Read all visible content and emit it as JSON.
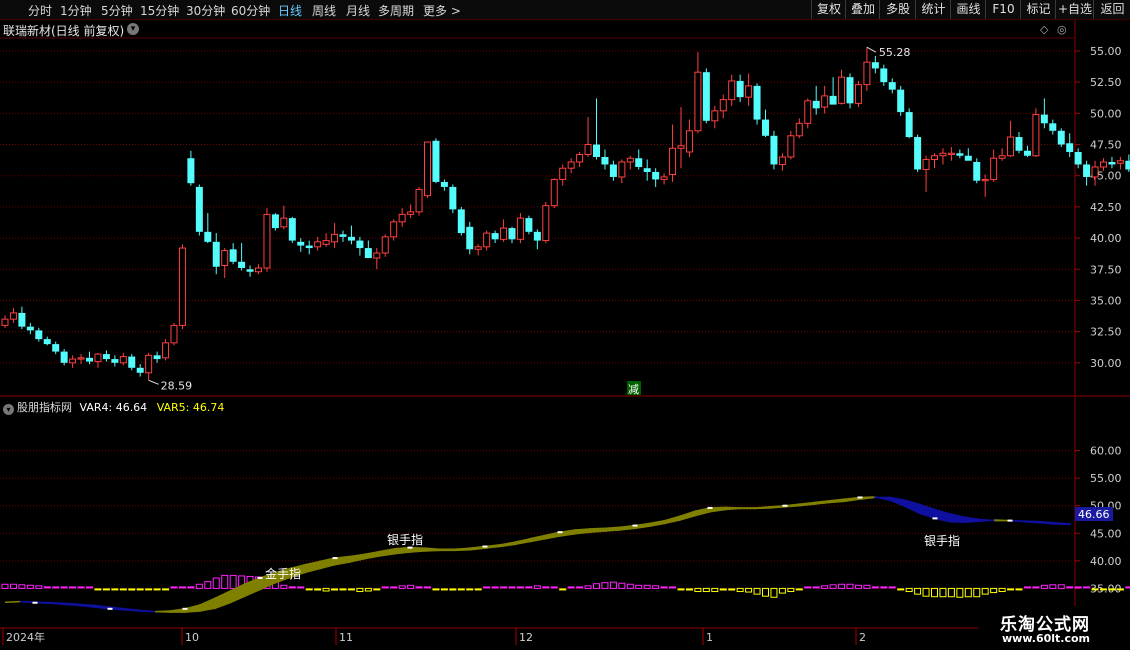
{
  "toolbar": {
    "periods": [
      "分时",
      "1分钟",
      "5分钟",
      "15分钟",
      "30分钟",
      "60分钟",
      "日线",
      "周线",
      "月线",
      "多周期",
      "更多 >"
    ],
    "active_period": "日线",
    "right_buttons": [
      "复权",
      "叠加",
      "多股",
      "统计",
      "画线",
      "F10",
      "标记",
      "+自选",
      "返回"
    ]
  },
  "stock": {
    "title": "联瑞新材(日线 前复权)"
  },
  "indicator": {
    "name": "股朋指标网",
    "var4": "VAR4: 46.64",
    "var5": "VAR5: 46.74",
    "var4_color": "#ffffff",
    "var5_color": "#ffff00",
    "current_value": "46.66"
  },
  "annotations": {
    "high": "55.28",
    "low": "28.59",
    "reduce_marker": "减",
    "gold_finger": "金手指",
    "silver_finger_1": "银手指",
    "silver_finger_2": "银手指"
  },
  "time_axis": {
    "labels": [
      "2024年",
      "10",
      "11",
      "12",
      "1",
      "2"
    ]
  },
  "watermark": {
    "line1": "乐淘公式网",
    "line2": "www.60lt.com"
  },
  "colors": {
    "up": "#ff4040",
    "down": "#54fcfc",
    "ribbon_up": "#808000",
    "ribbon_down": "#1010a0",
    "magenta": "#ff20ff",
    "yellow": "#ffff00",
    "grid": "#6e0000"
  },
  "chart_data": [
    {
      "type": "candlestick",
      "title": "联瑞新材(日线 前复权)",
      "y_ticks": [
        30.0,
        32.5,
        35.0,
        37.5,
        40.0,
        42.5,
        45.0,
        47.5,
        50.0,
        52.5,
        55.0
      ],
      "ylim": [
        27.5,
        56.2
      ],
      "high_label": 55.28,
      "low_label": 28.59,
      "ohlc": [
        [
          33.0,
          33.8,
          32.8,
          33.5
        ],
        [
          33.5,
          34.4,
          33.2,
          34.0
        ],
        [
          34.0,
          34.5,
          32.7,
          32.9
        ],
        [
          32.9,
          33.2,
          32.3,
          32.6
        ],
        [
          32.6,
          32.8,
          31.7,
          31.9
        ],
        [
          31.9,
          32.1,
          31.4,
          31.5
        ],
        [
          31.5,
          31.7,
          30.7,
          30.9
        ],
        [
          30.9,
          31.1,
          29.8,
          30.0
        ],
        [
          30.0,
          30.6,
          29.6,
          30.3
        ],
        [
          30.3,
          30.7,
          29.9,
          30.4
        ],
        [
          30.4,
          30.9,
          29.9,
          30.1
        ],
        [
          30.1,
          30.8,
          29.6,
          30.7
        ],
        [
          30.7,
          31.0,
          30.1,
          30.3
        ],
        [
          30.3,
          30.6,
          29.7,
          30.0
        ],
        [
          30.0,
          30.8,
          29.8,
          30.5
        ],
        [
          30.5,
          30.7,
          29.4,
          29.6
        ],
        [
          29.6,
          29.9,
          28.9,
          29.2
        ],
        [
          29.2,
          30.8,
          28.6,
          30.6
        ],
        [
          30.6,
          30.9,
          30.0,
          30.3
        ],
        [
          30.4,
          31.9,
          30.2,
          31.6
        ],
        [
          31.6,
          33.2,
          31.4,
          33.0
        ],
        [
          33.0,
          39.5,
          32.7,
          39.2
        ],
        [
          46.4,
          47.0,
          44.2,
          44.4
        ],
        [
          44.1,
          44.3,
          40.2,
          40.5
        ],
        [
          40.5,
          42.0,
          39.6,
          39.7
        ],
        [
          39.7,
          40.4,
          37.1,
          37.7
        ],
        [
          37.8,
          39.2,
          36.8,
          39.0
        ],
        [
          39.1,
          39.6,
          37.9,
          38.1
        ],
        [
          38.1,
          39.6,
          37.4,
          37.6
        ],
        [
          37.5,
          37.8,
          36.9,
          37.3
        ],
        [
          37.3,
          37.9,
          37.1,
          37.6
        ],
        [
          37.6,
          42.4,
          37.3,
          41.9
        ],
        [
          41.9,
          42.0,
          40.6,
          40.8
        ],
        [
          40.9,
          42.6,
          40.7,
          41.6
        ],
        [
          41.6,
          41.7,
          39.6,
          39.8
        ],
        [
          39.7,
          40.0,
          38.9,
          39.4
        ],
        [
          39.4,
          39.8,
          38.7,
          39.2
        ],
        [
          39.3,
          40.1,
          39.0,
          39.7
        ],
        [
          39.5,
          40.4,
          39.3,
          39.8
        ],
        [
          39.7,
          41.2,
          39.2,
          40.3
        ],
        [
          40.3,
          40.6,
          39.7,
          40.1
        ],
        [
          40.1,
          41.0,
          39.5,
          39.8
        ],
        [
          39.8,
          40.1,
          38.6,
          39.2
        ],
        [
          39.2,
          39.8,
          38.6,
          38.4
        ],
        [
          38.4,
          39.2,
          37.5,
          38.8
        ],
        [
          38.8,
          40.3,
          38.5,
          40.1
        ],
        [
          40.1,
          41.5,
          39.8,
          41.3
        ],
        [
          41.3,
          42.4,
          40.9,
          41.9
        ],
        [
          41.9,
          42.7,
          41.6,
          42.1
        ],
        [
          42.1,
          44.1,
          41.8,
          43.9
        ],
        [
          43.4,
          47.6,
          43.2,
          47.7
        ],
        [
          47.8,
          48.0,
          44.4,
          44.5
        ],
        [
          44.5,
          44.7,
          43.8,
          44.1
        ],
        [
          44.1,
          44.3,
          42.0,
          42.3
        ],
        [
          42.3,
          42.5,
          40.2,
          40.4
        ],
        [
          40.9,
          41.3,
          38.7,
          39.1
        ],
        [
          39.1,
          39.5,
          38.6,
          39.3
        ],
        [
          39.3,
          40.6,
          39.0,
          40.4
        ],
        [
          40.4,
          40.6,
          39.6,
          39.9
        ],
        [
          39.9,
          41.5,
          39.7,
          40.8
        ],
        [
          40.8,
          40.9,
          39.6,
          39.9
        ],
        [
          39.9,
          42.0,
          39.6,
          41.6
        ],
        [
          41.6,
          41.8,
          40.3,
          40.5
        ],
        [
          40.5,
          40.7,
          39.1,
          39.8
        ],
        [
          39.8,
          42.9,
          39.6,
          42.6
        ],
        [
          42.6,
          44.8,
          42.4,
          44.7
        ],
        [
          44.7,
          45.9,
          44.2,
          45.6
        ],
        [
          45.6,
          46.4,
          45.2,
          46.1
        ],
        [
          46.1,
          46.9,
          45.7,
          46.7
        ],
        [
          46.7,
          49.7,
          46.5,
          47.5
        ],
        [
          47.5,
          51.2,
          46.3,
          46.5
        ],
        [
          46.5,
          47.1,
          45.5,
          45.9
        ],
        [
          45.9,
          46.2,
          44.6,
          44.9
        ],
        [
          44.9,
          46.3,
          44.4,
          46.1
        ],
        [
          46.1,
          46.6,
          45.5,
          46.4
        ],
        [
          46.4,
          47.1,
          45.5,
          45.7
        ],
        [
          45.6,
          46.3,
          44.6,
          45.3
        ],
        [
          45.3,
          45.6,
          44.1,
          44.7
        ],
        [
          44.7,
          45.2,
          44.3,
          44.9
        ],
        [
          45.1,
          49.1,
          44.5,
          47.2
        ],
        [
          47.2,
          50.5,
          45.6,
          47.4
        ],
        [
          46.9,
          49.5,
          46.5,
          48.6
        ],
        [
          48.6,
          54.9,
          48.4,
          53.3
        ],
        [
          53.3,
          53.6,
          49.2,
          49.4
        ],
        [
          49.4,
          50.6,
          48.8,
          50.2
        ],
        [
          50.2,
          51.5,
          49.6,
          51.1
        ],
        [
          51.1,
          53.1,
          50.6,
          52.6
        ],
        [
          52.6,
          53.1,
          50.9,
          51.3
        ],
        [
          51.3,
          53.2,
          50.6,
          52.2
        ],
        [
          52.2,
          52.4,
          49.1,
          49.5
        ],
        [
          49.5,
          50.3,
          48.1,
          48.2
        ],
        [
          48.2,
          48.6,
          45.5,
          45.9
        ],
        [
          45.9,
          46.8,
          45.4,
          46.5
        ],
        [
          46.5,
          48.6,
          46.3,
          48.2
        ],
        [
          48.2,
          49.6,
          48.0,
          49.2
        ],
        [
          49.2,
          51.2,
          48.8,
          51.0
        ],
        [
          51.0,
          52.2,
          49.9,
          50.4
        ],
        [
          50.5,
          52.2,
          50.0,
          51.4
        ],
        [
          51.4,
          52.9,
          50.9,
          50.7
        ],
        [
          50.8,
          53.5,
          50.7,
          52.9
        ],
        [
          52.9,
          53.2,
          50.4,
          50.8
        ],
        [
          50.8,
          52.6,
          50.5,
          52.3
        ],
        [
          52.3,
          55.3,
          51.8,
          54.1
        ],
        [
          54.1,
          54.6,
          53.2,
          53.6
        ],
        [
          53.6,
          53.9,
          52.2,
          52.5
        ],
        [
          52.5,
          52.8,
          51.6,
          51.9
        ],
        [
          51.9,
          52.2,
          49.8,
          50.1
        ],
        [
          50.1,
          50.4,
          48.0,
          48.1
        ],
        [
          48.1,
          48.3,
          45.3,
          45.5
        ],
        [
          45.5,
          46.6,
          43.7,
          46.3
        ],
        [
          46.3,
          46.8,
          45.6,
          46.6
        ],
        [
          46.6,
          47.2,
          45.9,
          46.8
        ],
        [
          46.7,
          47.3,
          46.2,
          46.8
        ],
        [
          46.8,
          47.1,
          46.4,
          46.6
        ],
        [
          46.6,
          47.2,
          46.4,
          46.2
        ],
        [
          46.1,
          46.4,
          44.4,
          44.6
        ],
        [
          44.6,
          45.1,
          43.3,
          44.7
        ],
        [
          44.7,
          47.1,
          44.5,
          46.4
        ],
        [
          46.4,
          47.2,
          46.2,
          46.6
        ],
        [
          46.6,
          49.4,
          46.5,
          48.1
        ],
        [
          48.1,
          48.5,
          46.8,
          47.0
        ],
        [
          47.0,
          47.4,
          46.5,
          46.6
        ],
        [
          46.6,
          50.4,
          46.5,
          49.9
        ],
        [
          49.9,
          51.2,
          48.8,
          49.2
        ],
        [
          49.2,
          49.5,
          48.3,
          48.6
        ],
        [
          48.6,
          48.8,
          47.3,
          47.5
        ],
        [
          47.6,
          48.4,
          46.5,
          46.9
        ],
        [
          46.9,
          47.2,
          45.6,
          45.9
        ],
        [
          45.9,
          46.2,
          44.2,
          44.9
        ],
        [
          44.9,
          46.2,
          44.2,
          45.7
        ],
        [
          45.7,
          46.4,
          45.4,
          46.1
        ],
        [
          46.1,
          46.5,
          45.6,
          45.9
        ],
        [
          46.0,
          46.5,
          45.5,
          46.2
        ],
        [
          46.2,
          46.7,
          45.3,
          45.5
        ],
        [
          45.5,
          46.3,
          45.0,
          46.0
        ],
        [
          46.0,
          47.5,
          45.9,
          47.2
        ],
        [
          47.2,
          47.5,
          46.3,
          46.6
        ],
        [
          46.6,
          47.3,
          46.2,
          46.9
        ],
        [
          46.9,
          47.0,
          45.9,
          46.1
        ]
      ]
    },
    {
      "type": "indicator",
      "title": "股朋指标网",
      "y_ticks": [
        35.0,
        40.0,
        45.0,
        50.0,
        55.0,
        60.0
      ],
      "ylim": [
        28,
        67
      ],
      "var4": [
        32.5,
        32.6,
        32.4,
        32.3,
        32.1,
        31.9,
        31.6,
        31.3,
        31.1,
        30.9,
        30.8,
        30.9,
        31.3,
        32.0,
        33.2,
        34.5,
        35.8,
        36.9,
        37.8,
        38.6,
        39.3,
        39.9,
        40.5,
        40.8,
        41.2,
        41.7,
        42.2,
        42.4,
        42.3,
        42.1,
        42.1,
        42.3,
        42.6,
        42.9,
        43.4,
        44.0,
        44.6,
        45.2,
        45.6,
        45.8,
        45.9,
        46.1,
        46.4,
        46.8,
        47.3,
        48.1,
        49.0,
        49.6,
        49.7,
        49.6,
        49.6,
        49.8,
        50.0,
        50.3,
        50.6,
        50.9,
        51.2,
        51.5,
        51.6,
        51.0,
        49.9,
        48.6,
        47.7,
        47.1,
        47.0,
        47.2,
        47.4,
        47.3,
        47.1,
        46.9,
        46.7,
        46.6
      ],
      "var5": [
        32.5,
        32.6,
        32.5,
        32.4,
        32.3,
        32.1,
        31.9,
        31.6,
        31.3,
        31.0,
        30.8,
        30.7,
        30.7,
        30.9,
        31.4,
        32.4,
        33.6,
        34.8,
        36.0,
        37.0,
        37.9,
        38.6,
        39.3,
        39.8,
        40.4,
        40.9,
        41.3,
        41.6,
        41.8,
        41.9,
        41.9,
        42.0,
        42.3,
        42.6,
        43.0,
        43.5,
        44.0,
        44.5,
        44.9,
        45.2,
        45.4,
        45.6,
        45.9,
        46.3,
        46.8,
        47.4,
        48.2,
        48.9,
        49.3,
        49.5,
        49.5,
        49.6,
        49.8,
        50.0,
        50.3,
        50.6,
        50.8,
        51.2,
        51.5,
        51.5,
        51.0,
        50.2,
        49.3,
        48.5,
        47.9,
        47.5,
        47.3,
        47.3,
        47.2,
        47.1,
        46.9,
        46.7
      ],
      "histogram": [
        0.8,
        0.8,
        0.7,
        0.6,
        0.5,
        0.4,
        0.3,
        0.2,
        0.2,
        0.1,
        0.0,
        -0.1,
        -0.2,
        -0.2,
        -0.3,
        -0.4,
        -0.3,
        -0.2,
        -0.2,
        -0.1,
        0.0,
        0.2,
        0.4,
        0.8,
        1.3,
        2.0,
        2.5,
        2.5,
        2.4,
        2.3,
        2.2,
        1.7,
        1.2,
        0.6,
        0.4,
        0.2,
        -0.2,
        -0.4,
        -0.5,
        -0.4,
        -0.2,
        -0.2,
        -0.6,
        -0.5,
        -0.3,
        0.0,
        0.2,
        0.5,
        0.6,
        0.4,
        0.1,
        -0.2,
        -0.3,
        -0.4,
        -0.3,
        -0.2,
        -0.1,
        0.2,
        0.3,
        0.3,
        0.3,
        0.2,
        0.4,
        0.5,
        0.4,
        0.3,
        -0.1,
        0.1,
        0.2,
        0.5,
        0.9,
        1.1,
        1.2,
        1.0,
        0.8,
        0.6,
        0.6,
        0.5,
        0.3,
        0.2,
        -0.1,
        -0.4,
        -0.6,
        -0.6,
        -0.6,
        -0.4,
        -0.4,
        -0.6,
        -0.7,
        -1.1,
        -1.5,
        -1.7,
        -0.9,
        -0.6,
        -0.2,
        0.1,
        0.2,
        0.5,
        0.7,
        0.8,
        0.8,
        0.6,
        0.6,
        0.4,
        0.2,
        0.0,
        -0.2,
        -0.6,
        -1.1,
        -1.5,
        -1.6,
        -1.6,
        -1.6,
        -1.7,
        -1.6,
        -1.6,
        -1.1,
        -0.8,
        -0.6,
        -0.3,
        -0.2,
        0.0,
        0.3,
        0.6,
        0.7,
        0.7,
        0.4,
        0.2,
        0.0,
        -0.2,
        -0.3,
        -0.3,
        -0.1,
        0.0,
        -0.1,
        0.0,
        0.1,
        0.2,
        0.1,
        0.1
      ],
      "hist_baseline": 35.0
    }
  ]
}
